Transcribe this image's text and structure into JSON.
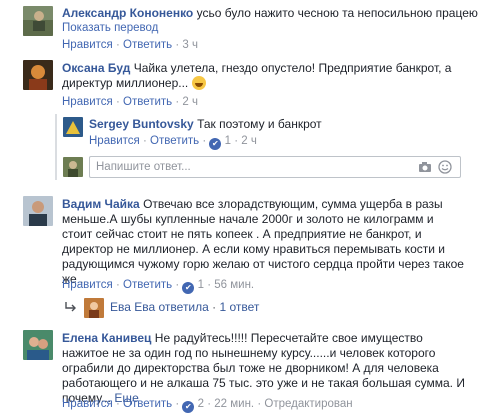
{
  "comments": [
    {
      "author": "Александр Кононенко",
      "text": "усьо було нажито чесною та непосильною працею",
      "translate": "Показать перевод",
      "like": "Нравится",
      "reply": "Ответить",
      "time": "3 ч"
    },
    {
      "author": "Оксана Буд",
      "text": "Чайка улетела, гнездо опустело! Предприятие банкрот, а директур миллионер...",
      "like": "Нравится",
      "reply": "Ответить",
      "time": "2 ч"
    },
    {
      "author": "Sergey Buntovsky",
      "text": "Так поэтому и банкрот",
      "like": "Нравится",
      "reply": "Ответить",
      "likes": "1",
      "time": "2 ч"
    },
    {
      "author": "Вадим Чайка",
      "text": "Отвечаю все злорадствующим, сумма ущерба в разы меньше.А шубы купленные начале 2000г и золото не килограмм и стоит сейчас стоит не пять копеек . А предприятие не банкрот, и директор не миллионер. А если кому нравиться перемывать кости и радующимся чужому горю желаю от чистого сердца пройти через такое же .",
      "like": "Нравится",
      "reply": "Ответить",
      "likes": "1",
      "time": "56 мин."
    },
    {
      "author": "Елена Канивец",
      "text": "Не радуйтесь!!!!! Пересчетайте свое имущество нажитое не за один год по нынешнему курсу......и человек которого ограбили до директорства был тоже не дворником! А для человека работающего и не алкаша 75 тыс. это уже и не такая большая сумма. И почему...",
      "more": "Еще",
      "like": "Нравится",
      "reply": "Ответить",
      "likes": "2",
      "time": "22 мин.",
      "edited": "Отредактирован"
    }
  ],
  "reply_input": {
    "placeholder": "Напишите ответ..."
  },
  "reply_summary": {
    "author": "Ева Ева",
    "action": "ответила",
    "count": "1 ответ"
  },
  "separator": "·",
  "icons": [
    "camera-icon",
    "smiley-icon",
    "like-icon",
    "reply-arrow-icon",
    "laughing-emoji-icon"
  ],
  "colors": {
    "link": "#365899",
    "meta": "#90949c",
    "like_blue": "#4267b2"
  }
}
